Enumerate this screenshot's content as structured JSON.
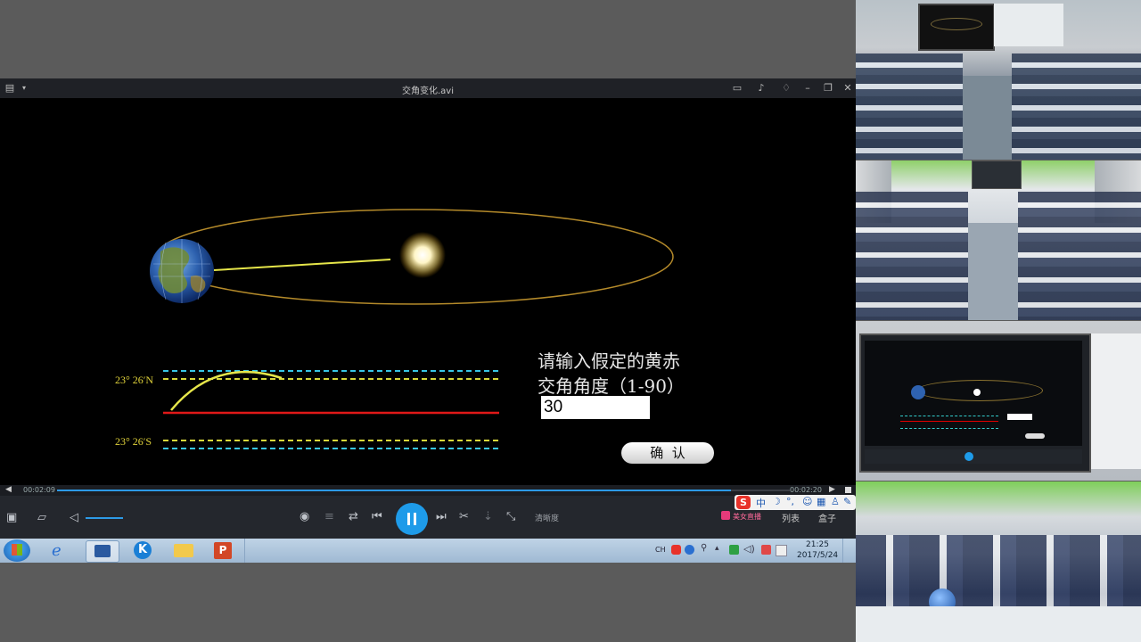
{
  "player": {
    "filename": "交角变化.avi",
    "time_elapsed": "00:02:09",
    "time_total": "00:02:20",
    "progress": 0.92,
    "quality_label": "清晰度",
    "list_label": "列表",
    "box_label": "盒子",
    "live_label": "美女直播"
  },
  "animation": {
    "label_north": "23° 26′N",
    "label_south": "23° 26′S",
    "prompt_line1": "请输入假定的黄赤",
    "prompt_line2": "交角角度（1-90）",
    "input_value": "30",
    "confirm_label": "确  认"
  },
  "ime": {
    "label": "中"
  },
  "taskbar": {
    "time": "21:25",
    "date": "2017/5/24",
    "tray_label": "CH"
  },
  "colors": {
    "orbit": "#b48a2a",
    "tropic_line": "#d9d93a",
    "polar_dash": "#38c6e6",
    "equator": "#e01818",
    "sun_path": "#e6e64a",
    "play_button": "#1e9be9"
  }
}
